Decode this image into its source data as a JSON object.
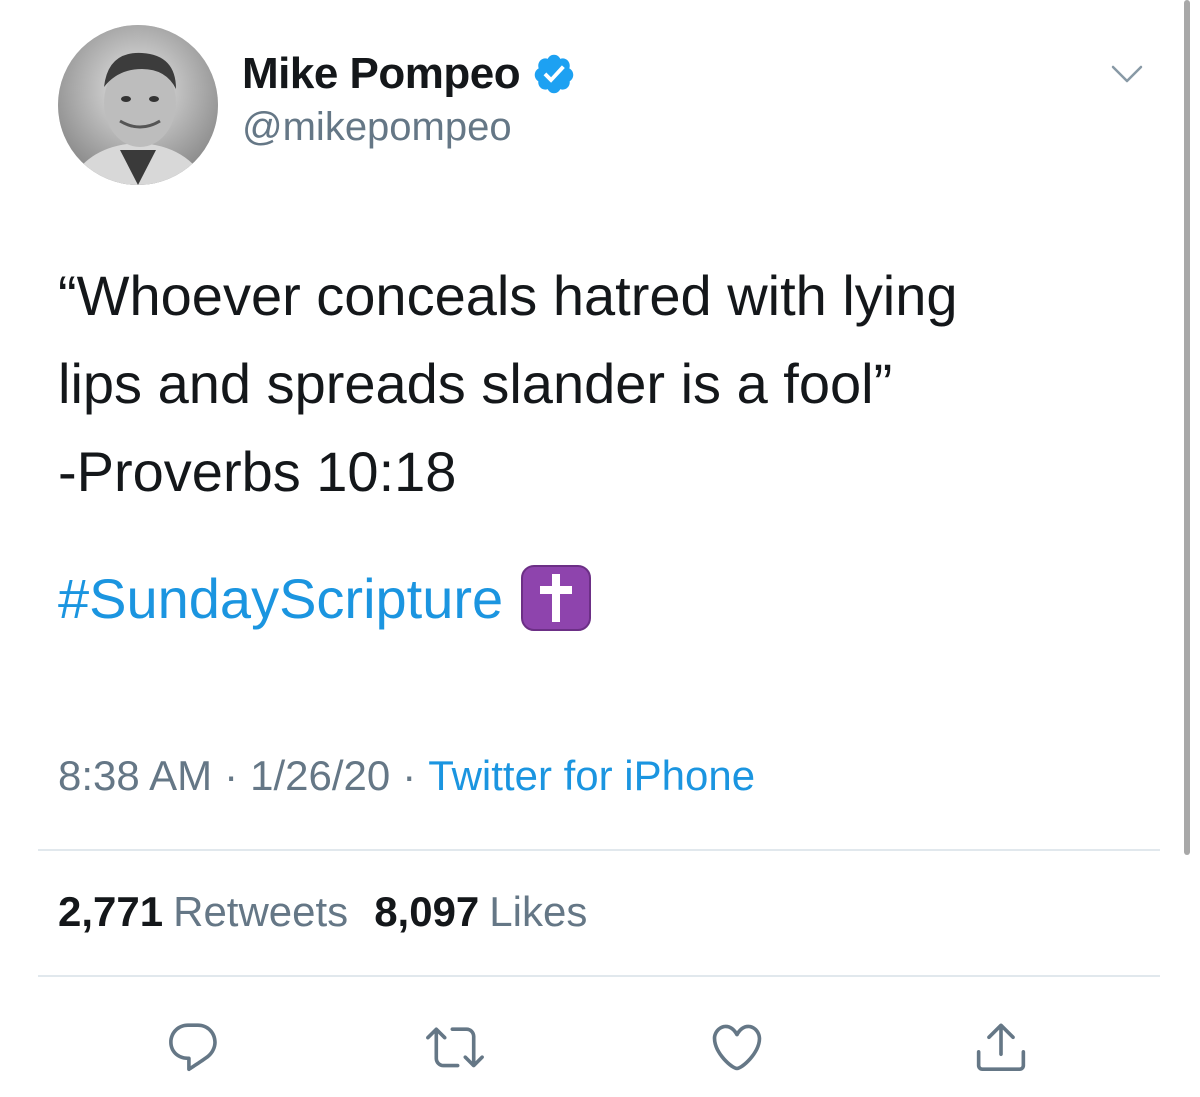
{
  "author": {
    "display_name": "Mike Pompeo",
    "handle": "@mikepompeo",
    "verified": true
  },
  "tweet": {
    "text_lines": [
      "“Whoever conceals hatred with lying",
      "lips and spreads slander is a fool”",
      "-Proverbs 10:18"
    ],
    "hashtag": "#SundayScripture",
    "emoji": "latin-cross-emoji"
  },
  "meta": {
    "time": "8:38 AM",
    "separator": "·",
    "date": "1/26/20",
    "source": "Twitter for iPhone"
  },
  "stats": {
    "retweets_count": "2,771",
    "retweets_label": "Retweets",
    "likes_count": "8,097",
    "likes_label": "Likes"
  },
  "actions": [
    "reply-icon",
    "retweet-icon",
    "like-icon",
    "share-icon"
  ],
  "colors": {
    "text": "#14171a",
    "secondary": "#657786",
    "link": "#1b95e0",
    "divider": "#e1e8ed",
    "verified": "#1da1f2",
    "emoji_bg": "#8e44ad"
  }
}
